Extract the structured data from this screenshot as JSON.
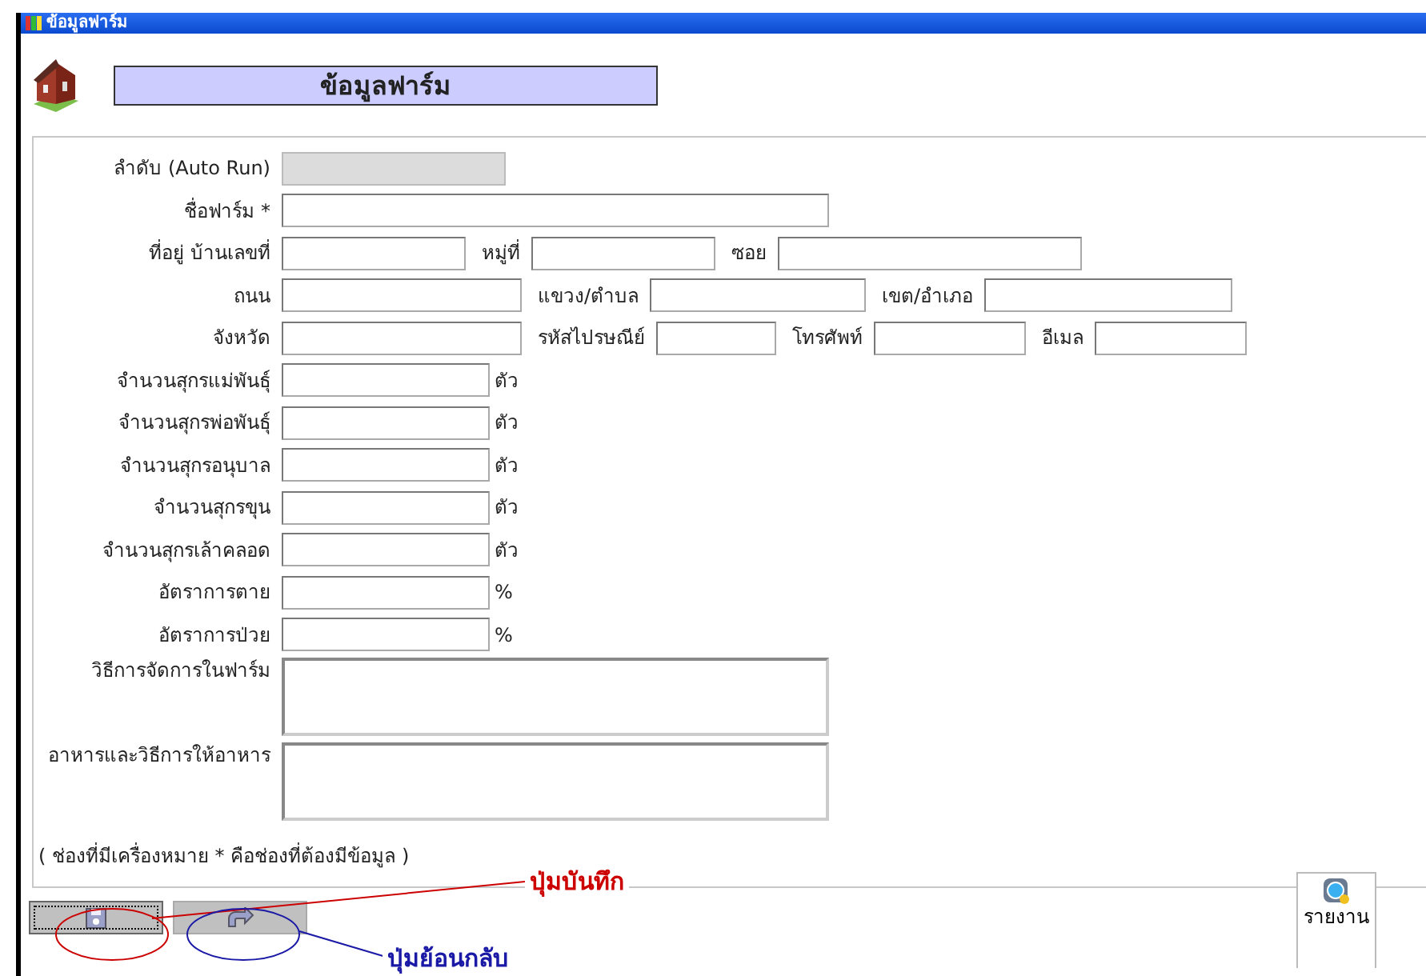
{
  "window": {
    "title": "ข้อมูลฟาร์ม"
  },
  "header": {
    "title": "ข้อมูลฟาร์ม"
  },
  "rows": [
    {
      "kind": "text",
      "label": "ลำดับ (Auto Run)",
      "inputs": [
        {
          "disabled": true
        }
      ]
    },
    {
      "kind": "text",
      "label": "ชื่อฟาร์ม *",
      "inputs": [
        {
          "disabled": false
        }
      ]
    },
    {
      "kind": "text",
      "label": "ที่อยู่ บ้านเลขที่",
      "inputs": [
        {
          "disabled": false
        },
        {
          "label": "หมู่ที่",
          "disabled": false
        },
        {
          "label": "ซอย",
          "disabled": false
        }
      ]
    },
    {
      "kind": "text",
      "label": "ถนน",
      "inputs": [
        {
          "disabled": false
        },
        {
          "label": "แขวง/ตำบล",
          "disabled": false
        },
        {
          "label": "เขต/อำเภอ",
          "disabled": false
        }
      ]
    },
    {
      "kind": "text",
      "label": "จังหวัด",
      "inputs": [
        {
          "disabled": false
        },
        {
          "label": "รหัสไปรษณีย์",
          "disabled": false
        },
        {
          "label": "โทรศัพท์",
          "disabled": false
        },
        {
          "label": "อีเมล",
          "disabled": false
        }
      ]
    },
    {
      "kind": "text",
      "label": "จำนวนสุกรแม่พันธุ์",
      "unit": "ตัว",
      "inputs": [
        {
          "disabled": false
        }
      ]
    },
    {
      "kind": "text",
      "label": "จำนวนสุกรพ่อพันธุ์",
      "unit": "ตัว",
      "inputs": [
        {
          "disabled": false
        }
      ]
    },
    {
      "kind": "text",
      "label": "จำนวนสุกรอนุบาล",
      "unit": "ตัว",
      "inputs": [
        {
          "disabled": false
        }
      ]
    },
    {
      "kind": "text",
      "label": "จำนวนสุกรขุน",
      "unit": "ตัว",
      "inputs": [
        {
          "disabled": false
        }
      ]
    },
    {
      "kind": "text",
      "label": "จำนวนสุกรเล้าคลอด",
      "unit": "ตัว",
      "inputs": [
        {
          "disabled": false
        }
      ]
    },
    {
      "kind": "text",
      "label": "อัตราการตาย",
      "unit": "%",
      "inputs": [
        {
          "disabled": false
        }
      ]
    },
    {
      "kind": "text",
      "label": "อัตราการป่วย",
      "unit": "%",
      "inputs": [
        {
          "disabled": false
        }
      ]
    },
    {
      "kind": "textarea",
      "label": "วิธีการจัดการในฟาร์ม",
      "inputs": [
        {
          "disabled": false
        }
      ]
    },
    {
      "kind": "textarea",
      "label": "อาหารและวิธีการให้อาหาร",
      "inputs": [
        {
          "disabled": false
        }
      ]
    }
  ],
  "note": "( ช่องที่มีเครื่องหมาย * คือช่องที่ต้องมีข้อมูล )",
  "buttons": [
    {
      "kind": "save",
      "focused": true
    },
    {
      "kind": "back",
      "focused": false
    }
  ],
  "annotations": [
    {
      "text": "ปุ่มบันทึก",
      "color": "#cc0000"
    },
    {
      "text": "ปุ่มย้อนกลับ",
      "color": "#1a1aa6"
    }
  ],
  "report_button": {
    "label": "รายงาน"
  }
}
